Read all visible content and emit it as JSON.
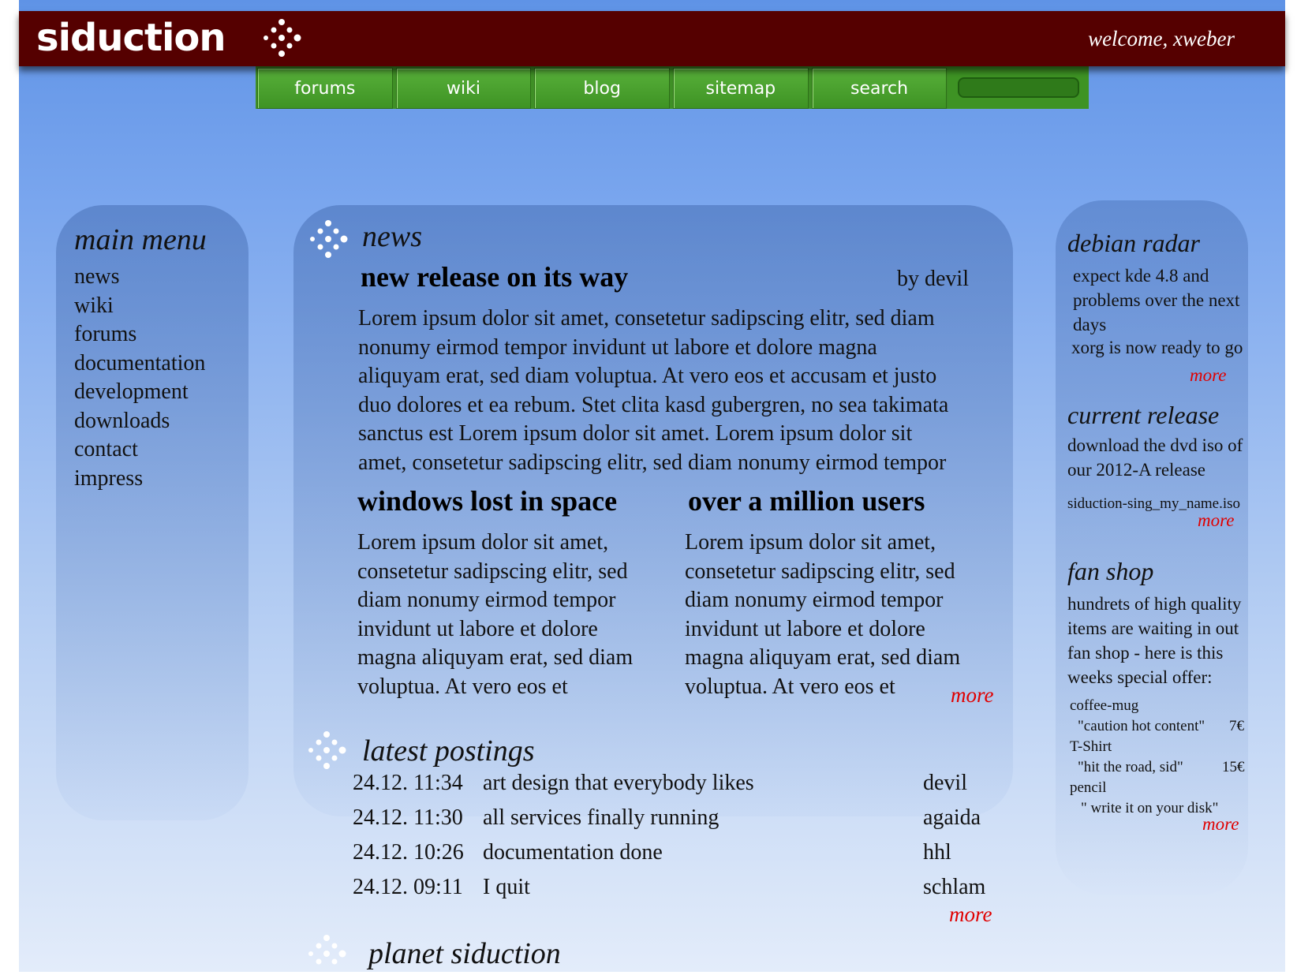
{
  "header": {
    "logo_text": "siduction",
    "welcome": "welcome, xweber",
    "background_color": "#550000"
  },
  "nav": {
    "items": [
      {
        "label": "forums"
      },
      {
        "label": "wiki"
      },
      {
        "label": "blog"
      },
      {
        "label": "sitemap"
      },
      {
        "label": "search"
      }
    ],
    "search_value": "",
    "accent_color": "#4a9e2f"
  },
  "main_menu": {
    "title": "main menu",
    "items": [
      "news",
      "wiki",
      "forums",
      "documentation",
      "development",
      "downloads",
      "contact",
      "impress"
    ]
  },
  "news": {
    "section_title": "news",
    "lead": {
      "title": "new release on its way",
      "author": "by devil",
      "lines": [
        "Lorem ipsum dolor sit amet, consetetur sadipscing elitr, sed diam",
        "nonumy eirmod tempor invidunt ut labore et dolore magna",
        "aliquyam erat, sed diam voluptua. At vero eos et accusam et justo",
        "duo dolores et ea rebum. Stet clita kasd gubergren, no sea takimata",
        "sanctus est Lorem ipsum dolor sit amet. Lorem ipsum dolor sit",
        "amet, consetetur sadipscing elitr, sed diam nonumy eirmod tempor"
      ]
    },
    "col1": {
      "title": "windows lost in space",
      "lines": [
        "Lorem ipsum dolor sit amet,",
        "consetetur sadipscing elitr, sed",
        "diam nonumy eirmod tempor",
        "invidunt ut labore et dolore",
        "magna aliquyam erat, sed diam",
        "voluptua. At vero eos et"
      ]
    },
    "col2": {
      "title": "over a million users",
      "lines": [
        "Lorem ipsum dolor sit amet,",
        "consetetur sadipscing elitr, sed",
        "diam nonumy eirmod tempor",
        "invidunt ut labore et dolore",
        "magna aliquyam erat, sed diam",
        "voluptua. At vero eos et"
      ]
    },
    "more": "more"
  },
  "latest_postings": {
    "title": "latest postings",
    "rows": [
      {
        "date": "24.12. 11:34",
        "title": "art design that everybody likes",
        "author": "devil"
      },
      {
        "date": "24.12. 11:30",
        "title": "all services finally running",
        "author": "agaida"
      },
      {
        "date": "24.12. 10:26",
        "title": "documentation done",
        "author": "hhl"
      },
      {
        "date": "24.12. 09:11",
        "title": "I quit",
        "author": "schlam"
      }
    ],
    "more": "more"
  },
  "planet": {
    "title": "planet siduction"
  },
  "sidebar": {
    "debian_radar": {
      "title": "debian radar",
      "lines": [
        "expect kde 4.8 and",
        "problems over the next",
        "days",
        "xorg is now ready to go"
      ],
      "more": "more"
    },
    "current_release": {
      "title": "current release",
      "lines": [
        "download the dvd iso of",
        "our 2012-A release"
      ],
      "file": "siduction-sing_my_name.iso",
      "more": "more"
    },
    "fan_shop": {
      "title": "fan shop",
      "lines": [
        "hundrets of high quality",
        "items are waiting in out",
        "fan shop - here is this",
        "weeks special offer:"
      ],
      "items": [
        {
          "name": "coffee-mug",
          "desc": "\"caution hot content\"",
          "price": "7€"
        },
        {
          "name": "T-Shirt",
          "desc": "\"hit the road, sid\"",
          "price": "15€"
        },
        {
          "name": "pencil",
          "desc": "\" write it on your disk\"",
          "price": ""
        }
      ],
      "more": "more"
    }
  },
  "colors": {
    "more_link": "#e00000",
    "nav_green": "#4a9e2f"
  }
}
